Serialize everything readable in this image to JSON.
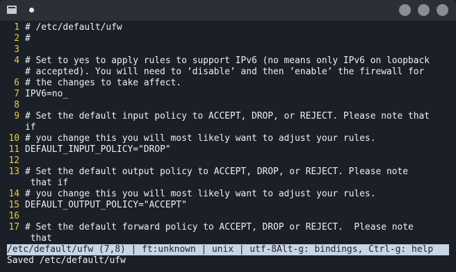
{
  "titlebar": {
    "unsaved_dot": "●"
  },
  "editor": {
    "lines": [
      {
        "num": "1",
        "text": "# /etc/default/ufw"
      },
      {
        "num": "2",
        "text": "#"
      },
      {
        "num": "3",
        "text": ""
      },
      {
        "num": "4",
        "text": "# Set to yes to apply rules to support IPv6 (no means only IPv6 on loopback"
      },
      {
        "num": "",
        "text": "# accepted). You will need to ’disable’ and then ’enable’ the firewall for"
      },
      {
        "num": "6",
        "text": "# the changes to take affect."
      },
      {
        "num": "7",
        "text": "IPV6=no_"
      },
      {
        "num": "8",
        "text": ""
      },
      {
        "num": "9",
        "text": "# Set the default input policy to ACCEPT, DROP, or REJECT. Please note that"
      },
      {
        "num": "",
        "text": "if"
      },
      {
        "num": "10",
        "text": "# you change this you will most likely want to adjust your rules."
      },
      {
        "num": "11",
        "text": "DEFAULT_INPUT_POLICY=\"DROP\""
      },
      {
        "num": "12",
        "text": ""
      },
      {
        "num": "13",
        "text": "# Set the default output policy to ACCEPT, DROP, or REJECT. Please note"
      },
      {
        "num": "",
        "text": " that if"
      },
      {
        "num": "14",
        "text": "# you change this you will most likely want to adjust your rules."
      },
      {
        "num": "15",
        "text": "DEFAULT_OUTPUT_POLICY=\"ACCEPT\""
      },
      {
        "num": "16",
        "text": ""
      },
      {
        "num": "17",
        "text": "# Set the default forward policy to ACCEPT, DROP or REJECT.  Please note"
      },
      {
        "num": "",
        "text": " that"
      }
    ]
  },
  "statusbar": {
    "text": "/etc/default/ufw (7,8) | ft:unknown | unix | utf-8Alt-g: bindings, Ctrl-g: help"
  },
  "message": {
    "text": "Saved /etc/default/ufw"
  },
  "colors": {
    "background": "#1b1f27",
    "line_number": "#e8cc45",
    "statusbar_bg": "#c9d4e6"
  }
}
